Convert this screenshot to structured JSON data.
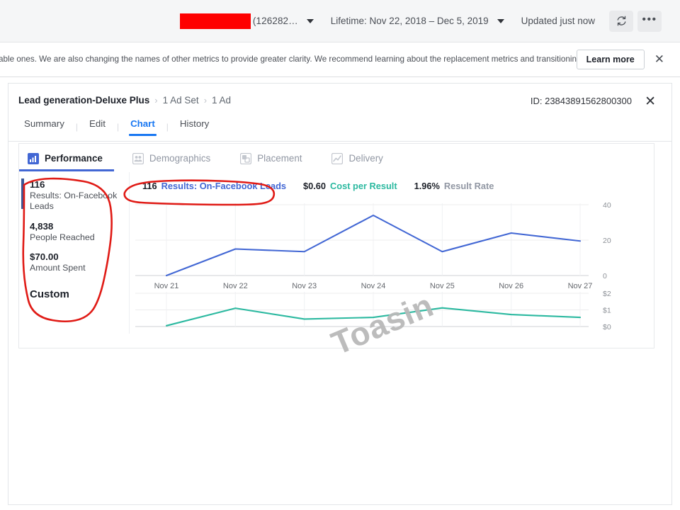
{
  "toolbar": {
    "account_id_text": "(126282…",
    "account_redacted": true,
    "date_range_label": "Lifetime: Nov 22, 2018 – Dec 5, 2019",
    "updated_label": "Updated just now",
    "refresh_icon": "refresh-icon",
    "more_icon": "ellipsis-icon",
    "caret_icon": "chevron-down-icon"
  },
  "banner": {
    "message": "able ones. We are also changing the names of other metrics to provide greater clarity. We recommend learning about the replacement metrics and transitioning to",
    "learn_more_label": "Learn more",
    "close_icon": "close-icon"
  },
  "panel": {
    "breadcrumb": {
      "campaign": "Lead generation-Deluxe Plus",
      "adset": "1 Ad Set",
      "ad": "1 Ad",
      "separator": "›"
    },
    "id_label": "ID: 23843891562800300",
    "close_icon": "close-icon",
    "tabs": [
      {
        "label": "Summary",
        "active": false
      },
      {
        "label": "Edit",
        "active": false
      },
      {
        "label": "Chart",
        "active": true
      },
      {
        "label": "History",
        "active": false
      }
    ]
  },
  "chart_card": {
    "tabs": [
      {
        "label": "Performance",
        "icon": "bar-chart-icon",
        "active": true
      },
      {
        "label": "Demographics",
        "icon": "people-icon",
        "active": false
      },
      {
        "label": "Placement",
        "icon": "placement-icon",
        "active": false
      },
      {
        "label": "Delivery",
        "icon": "line-chart-icon",
        "active": false
      }
    ],
    "metrics": [
      {
        "value": "116",
        "label": "Results: On-Facebook Leads",
        "selected": true
      },
      {
        "value": "4,838",
        "label": "People Reached",
        "selected": false
      },
      {
        "value": "$70.00",
        "label": "Amount Spent",
        "selected": false
      }
    ],
    "custom_label": "Custom",
    "legend": [
      {
        "value": "116",
        "name": "Results: On-Facebook Leads",
        "color": "#4267d4"
      },
      {
        "value": "$0.60",
        "name": "Cost per Result",
        "color": "#2cb9a0"
      },
      {
        "value": "1.96%",
        "name": "Result Rate",
        "color": "#9197a3"
      }
    ]
  },
  "chart_data": {
    "type": "line",
    "title": "",
    "xlabel": "",
    "categories": [
      "Nov 21",
      "Nov 22",
      "Nov 23",
      "Nov 24",
      "Nov 25",
      "Nov 26",
      "Nov 27"
    ],
    "panels": [
      {
        "name": "Results: On-Facebook Leads",
        "ylabel": "",
        "color": "#4267d4",
        "ylim": [
          0,
          40
        ],
        "yticks": [
          0,
          20,
          40
        ],
        "ytick_labels": [
          "0",
          "20",
          "40"
        ],
        "values": [
          0,
          15,
          13.5,
          34,
          13.5,
          24,
          19.5
        ],
        "grid": true
      },
      {
        "name": "Cost per Result",
        "ylabel": "",
        "color": "#2cb9a0",
        "ylim": [
          0,
          2
        ],
        "yticks": [
          0,
          1,
          2
        ],
        "ytick_labels": [
          "$0",
          "$1",
          "$2"
        ],
        "values": [
          0.05,
          1.1,
          0.45,
          0.55,
          1.12,
          0.72,
          0.55
        ],
        "grid": true
      }
    ],
    "legend_position": "top"
  },
  "watermark": {
    "text": "Toasin"
  },
  "annotations": {
    "color": "#e01b16",
    "shapes": [
      "metrics-panel-circle",
      "legend-item-circle"
    ]
  }
}
